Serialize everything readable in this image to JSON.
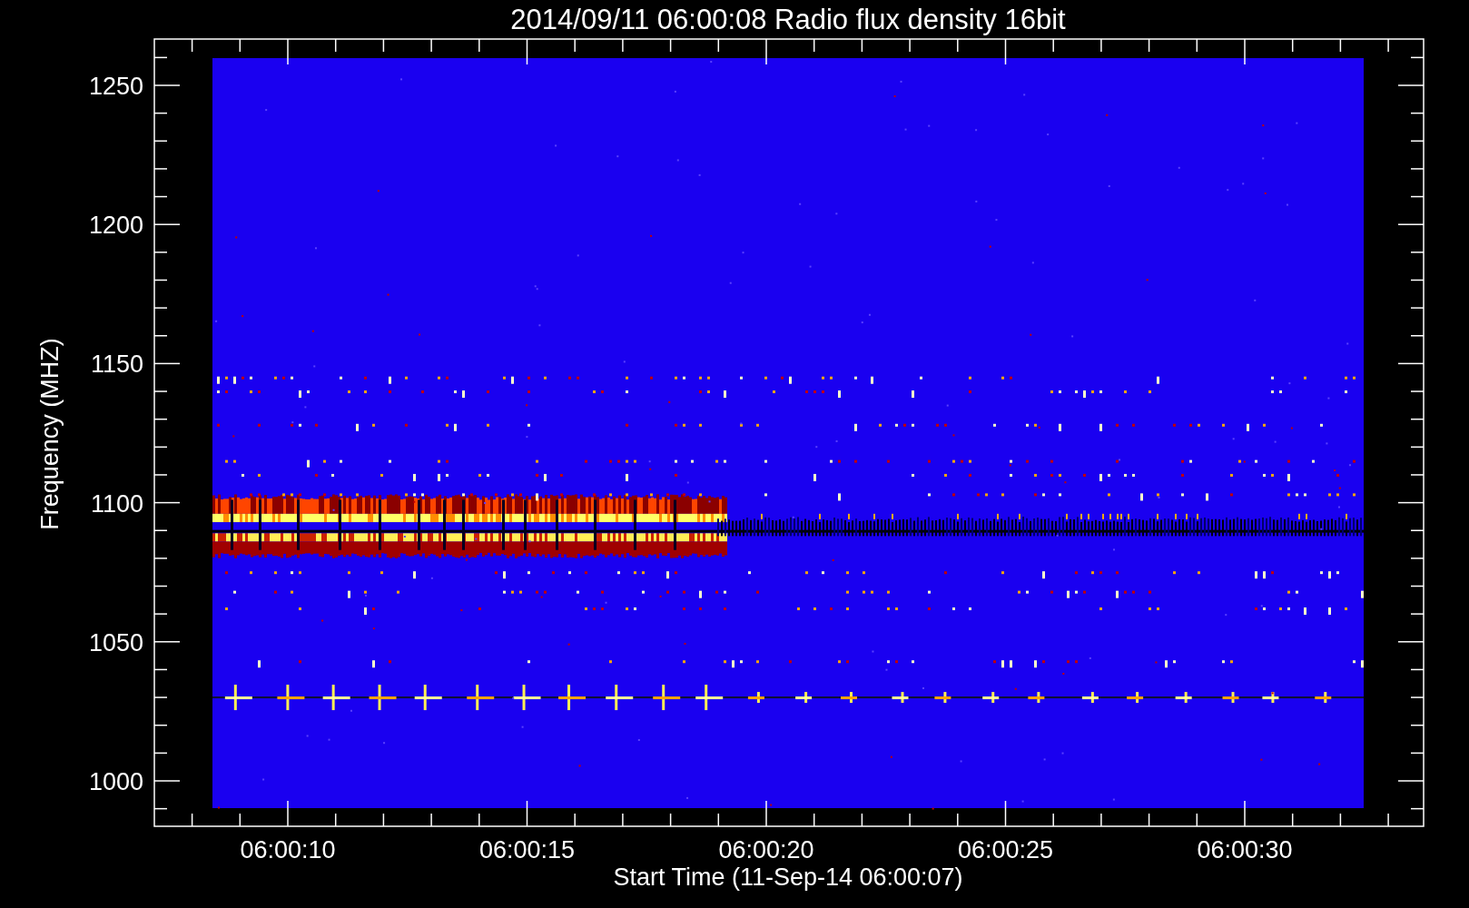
{
  "plot": {
    "title": "2014/09/11 06:00:08 Radio flux density 16bit",
    "ylabel": "Frequency (MHZ)",
    "xlabel": "Start Time (11-Sep-14 06:00:07)",
    "yticks": [
      "1250",
      "1200",
      "1150",
      "1100",
      "1050",
      "1000"
    ],
    "xticks": [
      "06:00:10",
      "06:00:15",
      "06:00:20",
      "06:00:25",
      "06:00:30"
    ]
  }
}
